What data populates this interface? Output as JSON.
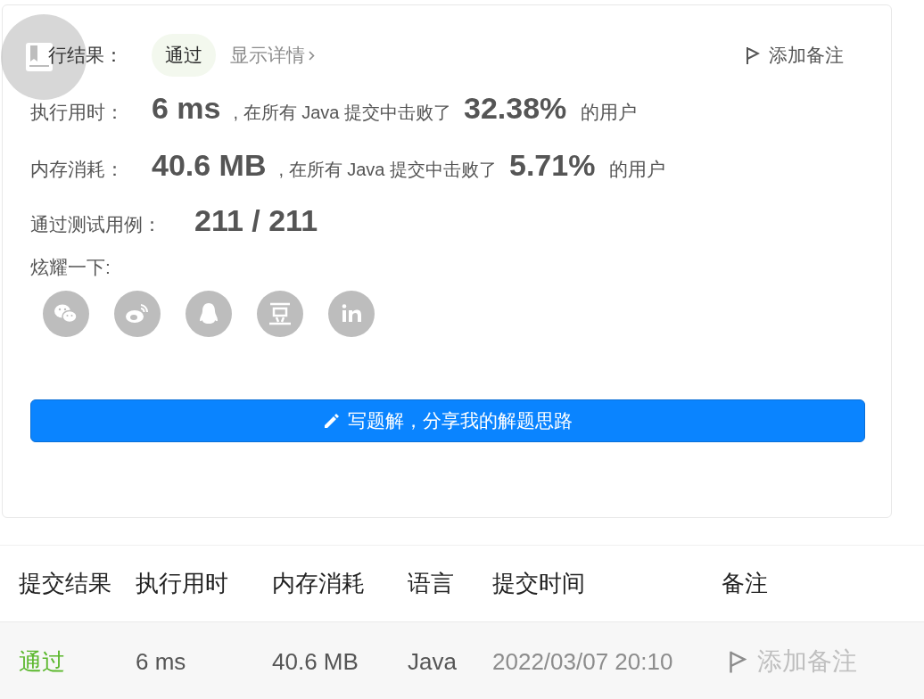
{
  "result": {
    "label": "行结果：",
    "status": "通过",
    "details_link": "显示详情",
    "note_button": "添加备注"
  },
  "stats": [
    {
      "label": "执行用时：",
      "value": "6 ms",
      "text": ", 在所有 Java 提交中击败了",
      "percent": "32.38%",
      "suffix": "的用户"
    },
    {
      "label": "内存消耗：",
      "value": "40.6 MB",
      "text": ", 在所有 Java 提交中击败了",
      "percent": "5.71%",
      "suffix": "的用户"
    }
  ],
  "tests": {
    "label": "通过测试用例：",
    "value": "211 / 211"
  },
  "share": {
    "label": "炫耀一下:",
    "buttons": [
      {
        "kind": "wechat"
      },
      {
        "kind": "weibo"
      },
      {
        "kind": "qq"
      },
      {
        "kind": "douban"
      },
      {
        "kind": "linkedin"
      }
    ]
  },
  "write_button": "写题解，分享我的解题思路",
  "table": {
    "columns": [
      "提交结果",
      "执行用时",
      "内存消耗",
      "语言",
      "提交时间",
      "备注"
    ],
    "rows": [
      {
        "status": "通过",
        "time": "6 ms",
        "memory": "40.6 MB",
        "language": "Java",
        "submitted": "2022/03/07 20:10",
        "note": "添加备注"
      }
    ]
  }
}
